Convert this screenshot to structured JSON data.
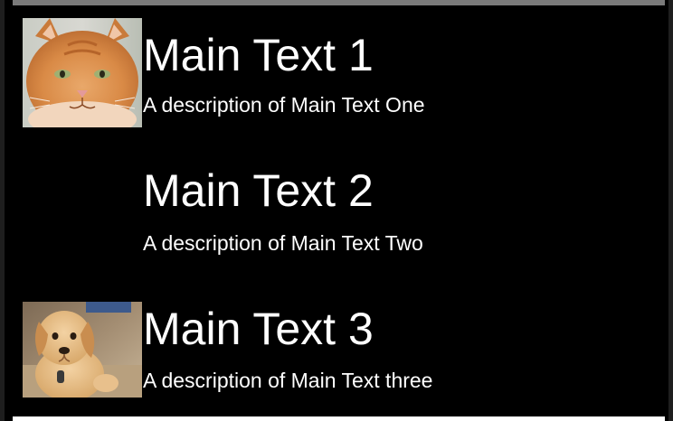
{
  "list": {
    "items": [
      {
        "title": "Main Text 1",
        "description": "A description of Main Text One",
        "image": "cat-photo"
      },
      {
        "title": "Main Text 2",
        "description": "A description of Main Text Two",
        "image": ""
      },
      {
        "title": "Main Text 3",
        "description": "A description of Main Text three",
        "image": "puppy-photo"
      }
    ]
  },
  "colors": {
    "background": "#000000",
    "text": "#ffffff",
    "top_bar": "#7a7a7a",
    "bottom_bar": "#ffffff"
  }
}
